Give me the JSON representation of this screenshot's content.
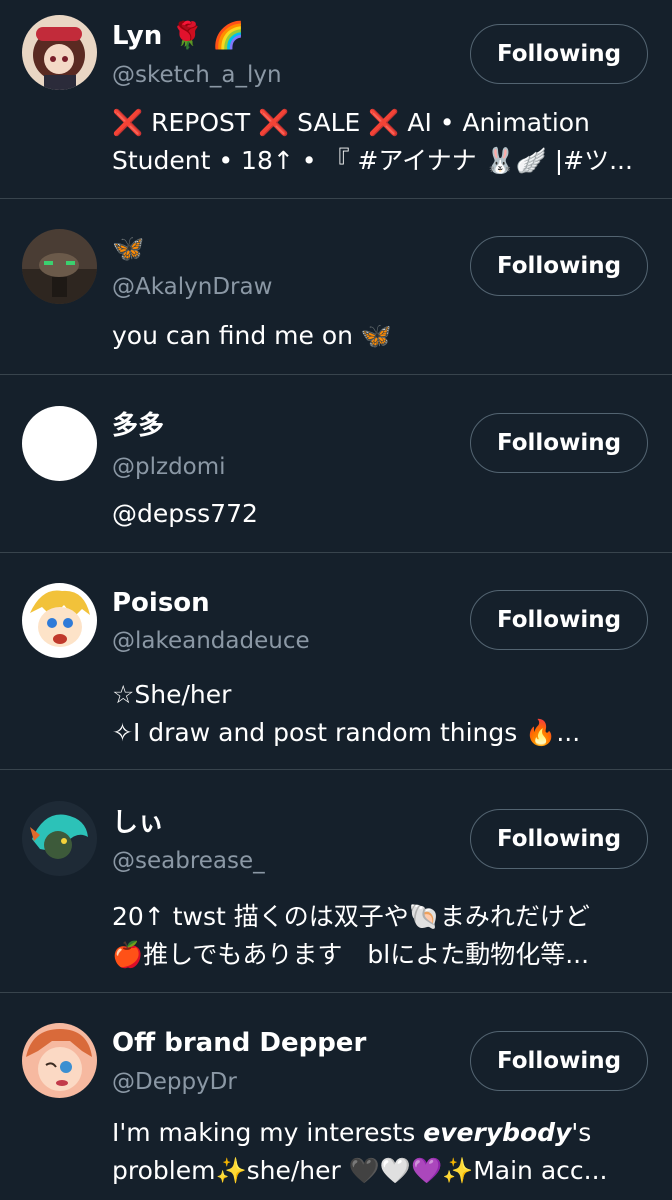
{
  "users": [
    {
      "name": "Lyn",
      "name_emoji": "🌹 🌈",
      "handle": "@sketch_a_lyn",
      "button_label": "Following",
      "bio_lines": [
        "❌ REPOST ❌ SALE ❌ AI • Animation",
        "Student • 18↑ • 『 #アイナナ 🐰🪽 |#ツ..."
      ]
    },
    {
      "name": "",
      "name_emoji": "🦋",
      "handle": "@AkalynDraw",
      "button_label": "Following",
      "bio_lines": [
        "you can find me on 🦋"
      ]
    },
    {
      "name": "多多",
      "name_emoji": "",
      "handle": "@plzdomi",
      "button_label": "Following",
      "bio_lines": [
        "@depss772"
      ]
    },
    {
      "name": "Poison",
      "name_emoji": "",
      "handle": "@lakeandadeuce",
      "button_label": "Following",
      "bio_lines": [
        "☆She/her",
        "✧I draw and post random things 🔥..."
      ]
    },
    {
      "name": "しぃ",
      "name_emoji": "",
      "handle": "@seabrease_",
      "button_label": "Following",
      "bio_lines": [
        "20↑ twst 描くのは双子や🐚まみれだけど",
        "🍎推しでもあります　blによた動物化等..."
      ]
    },
    {
      "name": "Off brand Depper",
      "name_emoji": "",
      "handle": "@DeppyDr",
      "button_label": "Following",
      "bio_line1_pre": "I'm making my interests ",
      "bio_line1_em": "everybody",
      "bio_line1_post": "'s",
      "bio_lines": [
        "problem✨she/her 🖤🤍💜✨Main acc..."
      ]
    }
  ],
  "colors": {
    "background": "#15202b",
    "divider": "#38444d",
    "secondary_text": "#8b98a5",
    "button_border": "#536471"
  }
}
